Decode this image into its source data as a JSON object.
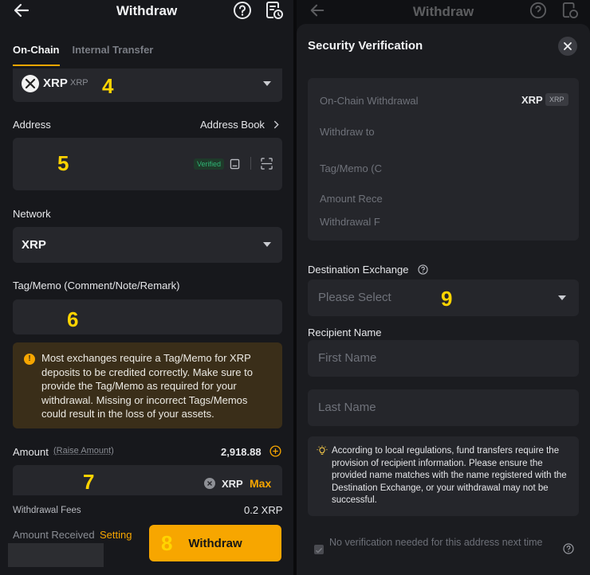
{
  "left": {
    "header": {
      "title": "Withdraw"
    },
    "tabs": [
      "On-Chain",
      "Internal Transfer"
    ],
    "coin": {
      "symbol": "XRP",
      "name": "XRP"
    },
    "address": {
      "label": "Address",
      "book_label": "Address Book",
      "verified": "Verified"
    },
    "network": {
      "label": "Network",
      "value": "XRP"
    },
    "tag": {
      "label": "Tag/Memo (Comment/Note/Remark)"
    },
    "warning": "Most exchanges require a Tag/Memo for XRP deposits to be credited correctly. Make sure to provide the Tag/Memo as required for your withdrawal. Missing or incorrect Tags/Memos could result in the loss of your assets.",
    "amount": {
      "label": "Amount",
      "raise": "(Raise Amount)",
      "available": "2,918.88",
      "unit": "XRP",
      "max": "Max"
    },
    "fees": {
      "label": "Withdrawal Fees",
      "value": "0.2 XRP"
    },
    "received": {
      "label": "Amount Received",
      "setting": "Setting"
    },
    "withdraw_button": "Withdraw",
    "markers": [
      "4",
      "5",
      "6",
      "7",
      "8"
    ]
  },
  "right": {
    "header": {
      "title": "Withdraw"
    },
    "sheet_title": "Security Verification",
    "summary": {
      "rows": [
        "On-Chain Withdrawal",
        "Withdraw to",
        "Tag/Memo (C",
        "Amount Rece",
        "Withdrawal F"
      ],
      "coin": "XRP",
      "coin_tag": "XRP"
    },
    "destination": {
      "label": "Destination Exchange",
      "placeholder": "Please Select"
    },
    "recipient": {
      "label": "Recipient Name",
      "first": "First Name",
      "last": "Last Name"
    },
    "info": "According to local regulations, fund transfers require the provision of recipient information. Please ensure the provided name matches with the name registered with the Destination Exchange, or your withdrawal may not be successful.",
    "checkbox_label": "No verification needed for this address next time",
    "marker": "9"
  }
}
